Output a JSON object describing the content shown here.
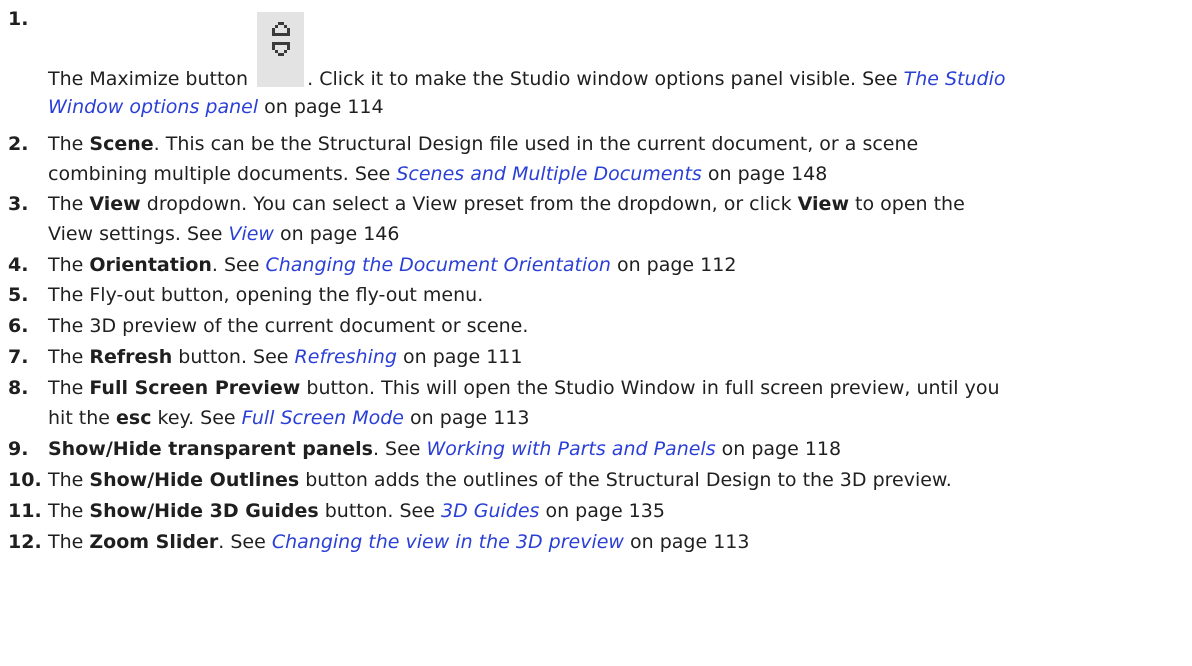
{
  "items": [
    {
      "number": "1.",
      "parts": [
        {
          "t": "The Maximize button "
        },
        {
          "icon": "maximize-icon"
        },
        {
          "t": ". Click it to make the Studio window options panel visible. See "
        },
        {
          "link": "The Studio"
        },
        {
          "br": true
        },
        {
          "link": "Window options panel"
        },
        {
          "t": " on page 114"
        }
      ]
    },
    {
      "number": "2.",
      "parts": [
        {
          "t": "The "
        },
        {
          "b": "Scene"
        },
        {
          "t": ". This can be the Structural Design file used in the current document, or a scene"
        },
        {
          "br": true
        },
        {
          "t": "combining multiple documents. See "
        },
        {
          "link": "Scenes and Multiple Documents"
        },
        {
          "t": " on page 148"
        }
      ]
    },
    {
      "number": "3.",
      "parts": [
        {
          "t": "The "
        },
        {
          "b": "View"
        },
        {
          "t": " dropdown. You can select a View preset from the dropdown, or click "
        },
        {
          "b": "View"
        },
        {
          "t": " to open the"
        },
        {
          "br": true
        },
        {
          "t": "View settings. See "
        },
        {
          "link": "View"
        },
        {
          "t": " on page 146"
        }
      ]
    },
    {
      "number": "4.",
      "parts": [
        {
          "t": "The "
        },
        {
          "b": "Orientation"
        },
        {
          "t": ". See "
        },
        {
          "link": "Changing the Document Orientation"
        },
        {
          "t": " on page 112"
        }
      ]
    },
    {
      "number": "5.",
      "parts": [
        {
          "t": "The Fly-out button, opening the fly-out menu."
        }
      ]
    },
    {
      "number": "6.",
      "parts": [
        {
          "t": "The 3D preview of the current document or scene."
        }
      ]
    },
    {
      "number": "7.",
      "parts": [
        {
          "t": "The "
        },
        {
          "b": "Refresh"
        },
        {
          "t": " button. See "
        },
        {
          "link": "Refreshing"
        },
        {
          "t": " on page 111"
        }
      ]
    },
    {
      "number": "8.",
      "parts": [
        {
          "t": "The "
        },
        {
          "b": "Full Screen Preview"
        },
        {
          "t": " button. This will open the Studio Window in full screen preview, until you"
        },
        {
          "br": true
        },
        {
          "t": "hit the "
        },
        {
          "b": "esc"
        },
        {
          "t": " key. See "
        },
        {
          "link": "Full Screen Mode"
        },
        {
          "t": " on page 113"
        }
      ]
    },
    {
      "number": "9.",
      "parts": [
        {
          "b": "Show/Hide transparent panels"
        },
        {
          "t": ". See "
        },
        {
          "link": "Working with Parts and Panels"
        },
        {
          "t": " on page 118"
        }
      ]
    },
    {
      "number": "10.",
      "parts": [
        {
          "t": "The "
        },
        {
          "b": "Show/Hide Outlines"
        },
        {
          "t": " button adds the outlines of the Structural Design to the 3D preview."
        }
      ]
    },
    {
      "number": "11.",
      "parts": [
        {
          "t": "The "
        },
        {
          "b": "Show/Hide 3D Guides"
        },
        {
          "t": " button. See "
        },
        {
          "link": "3D Guides"
        },
        {
          "t": " on page 135"
        }
      ]
    },
    {
      "number": "12.",
      "parts": [
        {
          "t": "The "
        },
        {
          "b": "Zoom Slider"
        },
        {
          "t": ". See "
        },
        {
          "link": "Changing the view in the 3D preview"
        },
        {
          "t": " on page 113"
        }
      ]
    }
  ]
}
